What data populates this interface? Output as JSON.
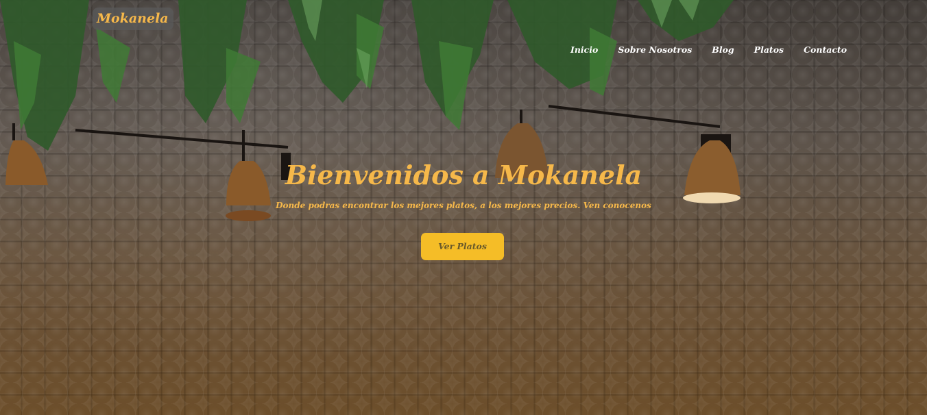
{
  "header": {
    "logo_text": "Mokanela",
    "nav": [
      {
        "label": "Inicio"
      },
      {
        "label": "Sobre Nosotros"
      },
      {
        "label": "Blog"
      },
      {
        "label": "Platos"
      },
      {
        "label": "Contacto"
      }
    ]
  },
  "hero": {
    "title": "Bienvenidos a Mokanela",
    "subtitle": "Donde podras encontrar los mejores platos, a los mejores precios. Ven conocenos",
    "cta_label": "Ver Platos"
  },
  "colors": {
    "accent": "#f6b84a",
    "button": "#f5bd27",
    "nav_text": "#ffffff"
  }
}
